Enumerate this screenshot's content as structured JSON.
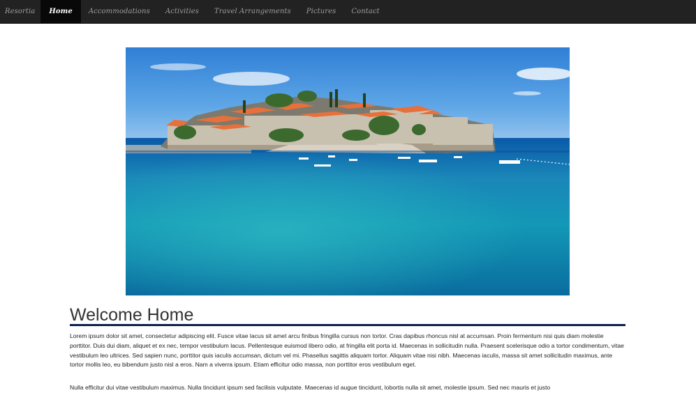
{
  "navbar": {
    "brand": "Resortia",
    "items": [
      {
        "label": "Home",
        "active": true
      },
      {
        "label": "Accommodations",
        "active": false
      },
      {
        "label": "Activities",
        "active": false
      },
      {
        "label": "Travel Arrangements",
        "active": false
      },
      {
        "label": "Pictures",
        "active": false
      },
      {
        "label": "Contact",
        "active": false
      }
    ]
  },
  "main": {
    "title": "Welcome Home",
    "paragraphs": [
      "Lorem ipsum dolor sit amet, consectetur adipiscing elit. Fusce vitae lacus sit amet arcu finibus fringilla cursus non tortor. Cras dapibus rhoncus nisl at accumsan. Proin fermentum nisi quis diam molestie porttitor. Duis dui diam, aliquet et ex nec, tempor vestibulum lacus. Pellentesque euismod libero odio, at fringilla elit porta id. Maecenas in sollicitudin nulla. Praesent scelerisque odio a tortor condimentum, vitae vestibulum leo ultrices. Sed sapien nunc, porttitor quis iaculis accumsan, dictum vel mi. Phasellus sagittis aliquam tortor. Aliquam vitae nisi nibh. Maecenas iaculis, massa sit amet sollicitudin maximus, ante tortor mollis leo, eu bibendum justo nisl a eros. Nam a viverra ipsum. Etiam efficitur odio massa, non porttitor eros vestibulum eget.",
      "Nulla efficitur dui vitae vestibulum maximus. Nulla tincidunt ipsum sed facilisis vulputate. Maecenas id augue tincidunt, lobortis nulla sit amet, molestie ipsum. Sed nec mauris et justo"
    ]
  },
  "colors": {
    "navbar_bg": "#222222",
    "navbar_active_bg": "#080808",
    "accent_rule": "#0a1f4e"
  },
  "icons": {
    "hero": "island-resort-photo"
  }
}
